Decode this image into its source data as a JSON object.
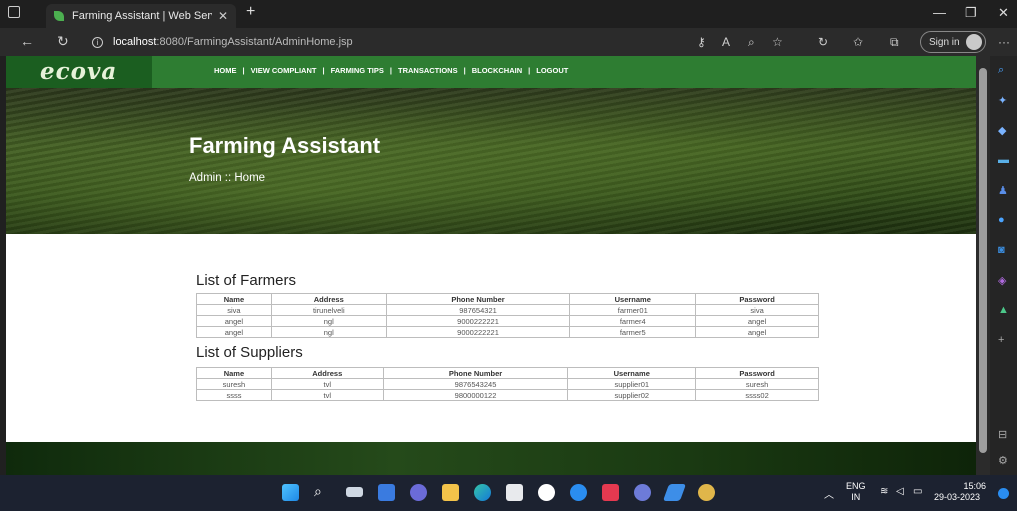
{
  "browser": {
    "tab_title": "Farming Assistant | Web Service I",
    "url_host": "localhost",
    "url_rest": ":8080/FarmingAssistant/AdminHome.jsp",
    "signin_label": "Sign in"
  },
  "site": {
    "logo": "ecova",
    "nav": [
      "HOME",
      "VIEW COMPLIANT",
      "FARMING TIPS",
      "TRANSACTIONS",
      "BLOCKCHAIN",
      "LOGOUT"
    ],
    "nav_separator": "|",
    "hero_title": "Farming Assistant",
    "breadcrumb": "Admin  ::  Home"
  },
  "farmers": {
    "title": "List of Farmers",
    "columns": [
      "Name",
      "Address",
      "Phone Number",
      "Username",
      "Password"
    ],
    "rows": [
      [
        "siva",
        "tirunelveli",
        "987654321",
        "farmer01",
        "siva"
      ],
      [
        "angel",
        "ngl",
        "9000222221",
        "farmer4",
        "angel"
      ],
      [
        "angel",
        "ngl",
        "9000222221",
        "farmer5",
        "angel"
      ]
    ]
  },
  "suppliers": {
    "title": "List of Suppliers",
    "columns": [
      "Name",
      "Address",
      "Phone Number",
      "Username",
      "Password"
    ],
    "rows": [
      [
        "suresh",
        "tvl",
        "9876543245",
        "supplier01",
        "suresh"
      ],
      [
        "ssss",
        "tvl",
        "9800000122",
        "supplier02",
        "ssss02"
      ]
    ]
  },
  "taskbar": {
    "lang_top": "ENG",
    "lang_bottom": "IN",
    "time": "15:06",
    "date": "29-03-2023"
  },
  "colors": {
    "nav_green": "#2e7d32",
    "logo_green": "#1b5e20"
  }
}
